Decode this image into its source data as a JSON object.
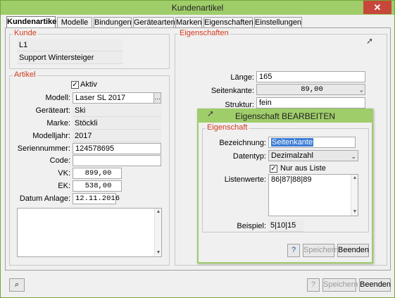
{
  "window": {
    "title": "Kundenartikel",
    "close": "✕"
  },
  "tabs": [
    {
      "label": "Kundenartikel",
      "active": true
    },
    {
      "label": "Modelle"
    },
    {
      "label": "Bindungen"
    },
    {
      "label": "Gerätearten"
    },
    {
      "label": "Marken"
    },
    {
      "label": "Eigenschaften"
    },
    {
      "label": "Einstellungen"
    }
  ],
  "kunde": {
    "title": "Kunde",
    "line1": "L1",
    "line2": "Support Wintersteiger"
  },
  "artikel": {
    "title": "Artikel",
    "aktiv_label": "Aktiv",
    "modell_label": "Modell:",
    "modell_value": "Laser SL 2017",
    "geraeteart_label": "Geräteart:",
    "geraeteart_value": "Ski",
    "marke_label": "Marke:",
    "marke_value": "Stöckli",
    "modelljahr_label": "Modelljahr:",
    "modelljahr_value": "2017",
    "seriennummer_label": "Seriennummer:",
    "seriennummer_value": "124578695",
    "code_label": "Code:",
    "code_value": "",
    "vk_label": "VK:",
    "vk_value": "899,00",
    "ek_label": "EK:",
    "ek_value": "538,00",
    "datum_label": "Datum Anlage:",
    "datum_value": "12.11.2016"
  },
  "eigenschaften": {
    "title": "Eigenschaften",
    "laenge_label": "Länge:",
    "laenge_value": "165",
    "seitenkante_label": "Seitenkante:",
    "seitenkante_value": "89,00",
    "struktur_label": "Struktur:",
    "struktur_value": "fein"
  },
  "dialog": {
    "title": "Eigenschaft BEARBEITEN",
    "group_title": "Eigenschaft",
    "bezeichnung_label": "Bezeichnung:",
    "bezeichnung_value": "Seitenkante",
    "datentyp_label": "Datentyp:",
    "datentyp_value": "Dezimalzahl",
    "nur_aus_liste_label": "Nur aus Liste",
    "listenwerte_label": "Listenwerte:",
    "listenwerte_value": "86|87|88|89",
    "beispiel_label": "Beispiel:",
    "beispiel_value": "5|10|15",
    "speichern_label": "Speichern",
    "beenden_label": "Beenden"
  },
  "footer": {
    "speichern_label": "Speichern",
    "beenden_label": "Beenden"
  },
  "colors": {
    "accent": "#9fcd6a",
    "group_title": "#d23a1e",
    "selection": "#3a7bd5"
  }
}
